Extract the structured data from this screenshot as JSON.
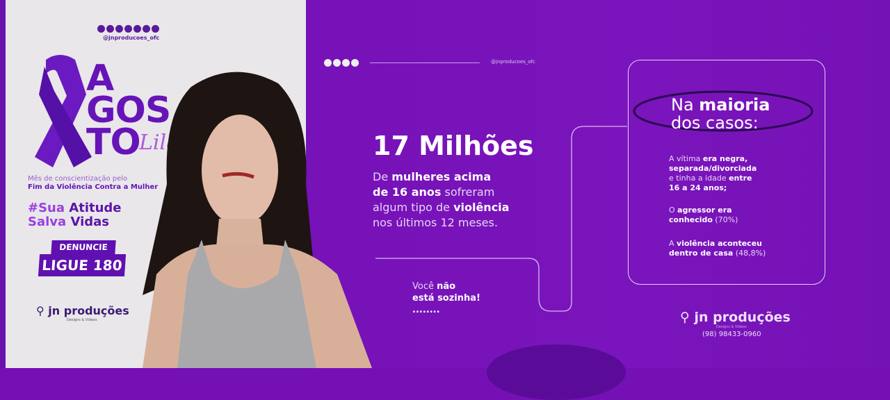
{
  "left": {
    "social_handle": "@jnproducoes_ofc",
    "title_lines": [
      "A",
      "GOS",
      "TO"
    ],
    "title_script": "Lilás",
    "subtitle_1": "Mês de conscientização pelo",
    "subtitle_2": "Fim da Violência Contra a Mulher",
    "hashtag": {
      "part1": "#Sua",
      "part2": "Atitude",
      "part3": "Salva",
      "part4": "Vidas"
    },
    "badge_top": "DENUNCIE",
    "badge_bottom": "LIGUE 180",
    "brand": "jn produções",
    "brand_tag": "Designs & Vídeos"
  },
  "middle": {
    "social_handle": "@jnproducoes_ofc",
    "headline": "17 Milhões",
    "body": [
      {
        "t": "De ",
        "b": "mulheres acima"
      },
      {
        "t": "",
        "b": "de 16 anos",
        "t2": " sofreram"
      },
      {
        "t": "algum tipo de ",
        "b": "violência"
      },
      {
        "t": "nos últimos 12 meses."
      }
    ],
    "note_1": "Você ",
    "note_1b": "não",
    "note_2": "está sozinha!",
    "dots": "........"
  },
  "right": {
    "heading_1": "Na ",
    "heading_1b": "maioria",
    "heading_2": "dos casos:",
    "fact1": [
      {
        "t": "A vítima ",
        "b": "era negra,"
      },
      {
        "b": "separada/divorciada"
      },
      {
        "t": "e tinha a idade ",
        "b": "entre"
      },
      {
        "b": "16 a 24 anos;"
      }
    ],
    "fact2": [
      {
        "t": "O ",
        "b": "agressor era"
      },
      {
        "b": "conhecido",
        "t2": " (70%)"
      }
    ],
    "fact3": [
      {
        "t": "A ",
        "b": "violência aconteceu"
      },
      {
        "b": "dentro de casa",
        "t2": " (48,8%)"
      }
    ],
    "brand": "jn produções",
    "brand_tag": "Designs & Vídeos",
    "phone": "(98) 98433-0960"
  },
  "colors": {
    "purple": "#7510b5",
    "light_bg": "#e9e7ea",
    "ribbon": "#6a1ac0"
  }
}
